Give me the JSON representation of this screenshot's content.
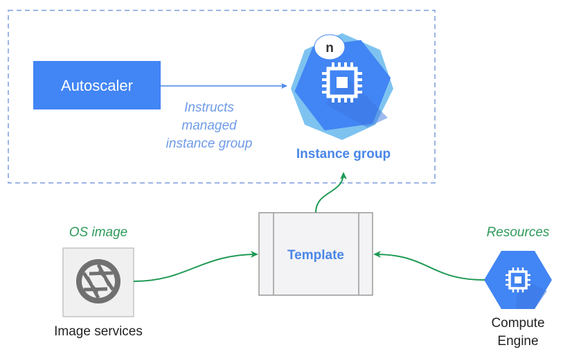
{
  "autoscaler": {
    "label": "Autoscaler"
  },
  "instructs": {
    "lines": [
      "Instructs",
      "managed",
      "instance group"
    ]
  },
  "instance_group": {
    "label": "Instance group",
    "badge": "n",
    "icon": "cpu-chip-icon"
  },
  "template": {
    "label": "Template"
  },
  "os_image": {
    "caption": "OS image",
    "label": "Image services",
    "icon": "camera-aperture-icon"
  },
  "resources": {
    "caption": "Resources",
    "label_lines": [
      "Compute",
      "Engine"
    ],
    "icon": "cpu-chip-icon"
  },
  "colors": {
    "blue": "#4285f4",
    "light_blue": "#7ec3f0",
    "green": "#1e9a54",
    "dashed": "#7b9be0",
    "text_blue": "#4a86e8",
    "green_text": "#2e9a5a"
  }
}
